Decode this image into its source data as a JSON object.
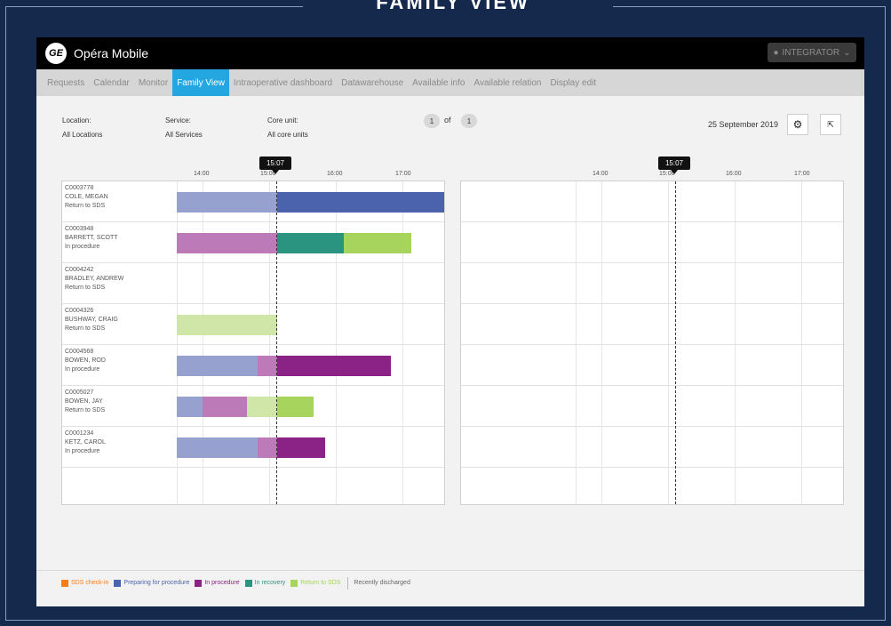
{
  "page_title": "FAMILY VIEW",
  "app": {
    "name": "Opéra Mobile",
    "logo_text": "GE",
    "user_label": "INTEGRATOR"
  },
  "nav": [
    "Requests",
    "Calendar",
    "Monitor",
    "Family View",
    "Intraoperative dashboard",
    "Datawarehouse",
    "Available info",
    "Available relation",
    "Display edit"
  ],
  "active_nav": "Family View",
  "filters": {
    "location_label": "Location:",
    "location_value": "All Locations",
    "service_label": "Service:",
    "service_value": "All Services",
    "core_label": "Core unit:",
    "core_value": "All core units"
  },
  "pagination": {
    "current": "1",
    "of_label": "of",
    "total": "1"
  },
  "date": "25 September 2019",
  "now_time": "15:07",
  "axis_ticks": [
    "14:00",
    "15:00",
    "16:00",
    "17:00"
  ],
  "patients": [
    {
      "id": "C0003778",
      "name": "COLE, MEGAN",
      "status": "Return to SDS"
    },
    {
      "id": "C0003948",
      "name": "BARRETT, SCOTT",
      "status": "In procedure"
    },
    {
      "id": "C0004242",
      "name": "BRADLEY, ANDREW",
      "status": "Return to SDS"
    },
    {
      "id": "C0004326",
      "name": "BUSHWAY, CRAIG",
      "status": "Return to SDS"
    },
    {
      "id": "C0004568",
      "name": "BOWEN, ROD",
      "status": "In procedure"
    },
    {
      "id": "C0005027",
      "name": "BOWEN, JAY",
      "status": "Return to SDS"
    },
    {
      "id": "C0001234",
      "name": "KETZ, CAROL",
      "status": "In procedure"
    }
  ],
  "legend": [
    {
      "label": "SDS check-in",
      "color": "#f07f1e"
    },
    {
      "label": "Preparing for procedure",
      "color": "#4b63ad"
    },
    {
      "label": "In procedure",
      "color": "#8b2286"
    },
    {
      "label": "In recovery",
      "color": "#2a9481"
    },
    {
      "label": "Return to SDS",
      "color": "#a6d45c"
    }
  ],
  "legend_extra": "Recently discharged"
}
